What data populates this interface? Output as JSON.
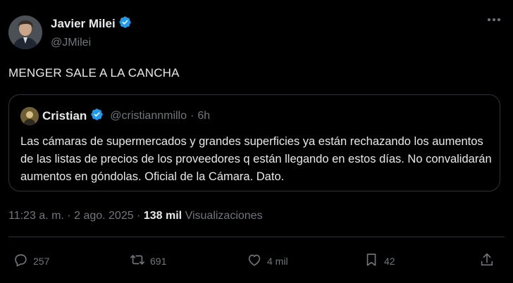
{
  "author": {
    "name": "Javier Milei",
    "handle": "@JMilei",
    "verified_color": "#1d9bf0"
  },
  "tweet": {
    "text": "MENGER SALE A LA CANCHA"
  },
  "quote": {
    "name": "Cristian",
    "handle": "@cristiannmillo",
    "separator": "·",
    "time": "6h",
    "text": "Las cámaras de supermercados y grandes superficies ya están rechazando los aumentos de las listas de precios de los proveedores q están llegando en estos días. No convalidarán aumentos en góndolas. Oficial de la Cámara. Dato."
  },
  "meta": {
    "time": "11:23 a. m.",
    "separator": "·",
    "date": "2 ago. 2025",
    "views_count": "138 mil",
    "views_label": "Visualizaciones"
  },
  "actions": {
    "replies": "257",
    "reposts": "691",
    "likes": "4 mil",
    "bookmarks": "42"
  },
  "icons": [
    "verified-badge-icon",
    "more-icon",
    "reply-icon",
    "repost-icon",
    "like-icon",
    "bookmark-icon",
    "share-icon"
  ]
}
